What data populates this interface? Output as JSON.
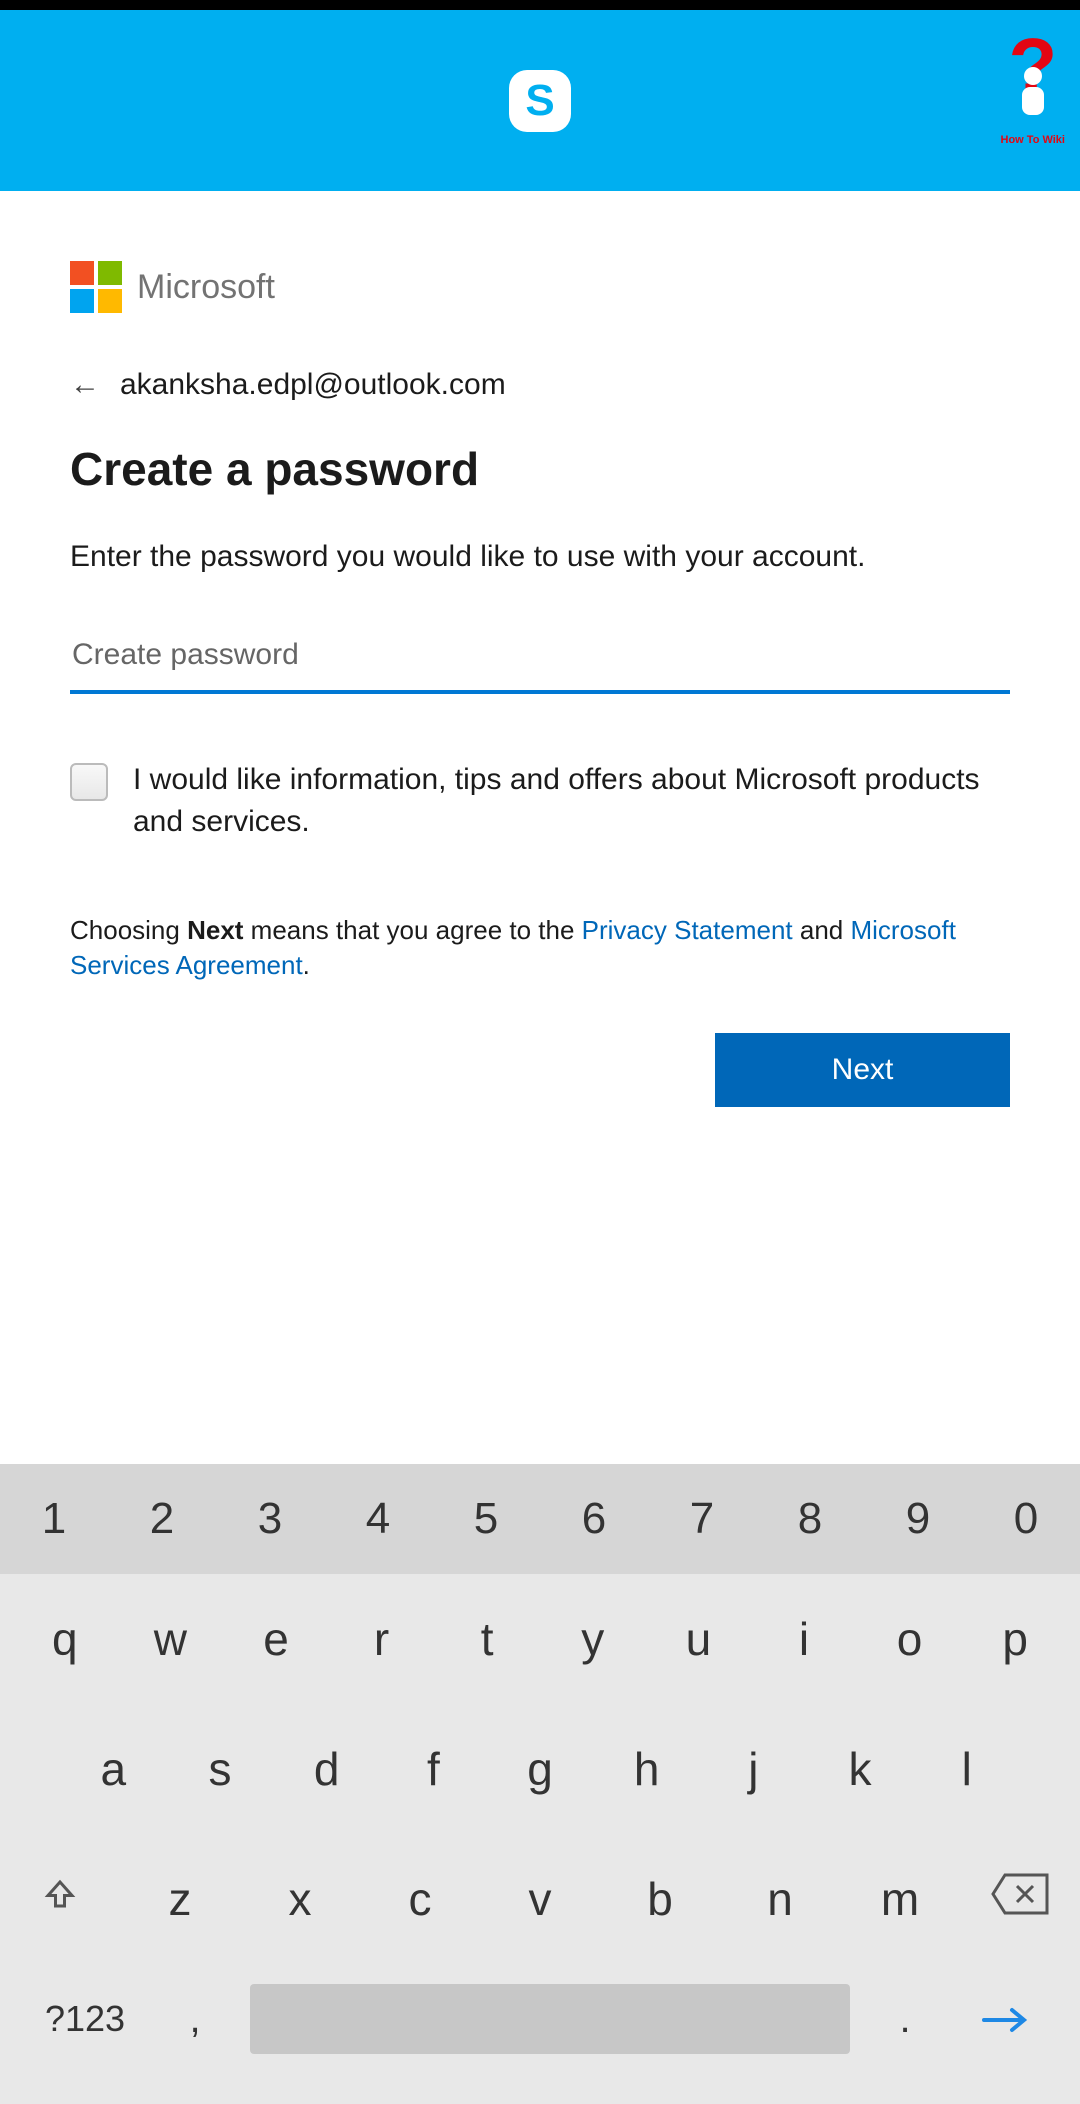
{
  "header": {
    "watermark_text": "How To Wiki"
  },
  "microsoft_label": "Microsoft",
  "email": "akanksha.edpl@outlook.com",
  "title": "Create a password",
  "instruction": "Enter the password you would like to use with your account.",
  "password_placeholder": "Create password",
  "checkbox_label": "I would like information, tips and offers about Microsoft products and services.",
  "agreement": {
    "prefix": "Choosing ",
    "bold": "Next",
    "mid": " means that you agree to the ",
    "link1": "Privacy Statement",
    "and": " and ",
    "link2": "Microsoft Services Agreement",
    "suffix": "."
  },
  "next_button": "Next",
  "keyboard": {
    "numbers": [
      "1",
      "2",
      "3",
      "4",
      "5",
      "6",
      "7",
      "8",
      "9",
      "0"
    ],
    "row1": [
      "q",
      "w",
      "e",
      "r",
      "t",
      "y",
      "u",
      "i",
      "o",
      "p"
    ],
    "row2": [
      "a",
      "s",
      "d",
      "f",
      "g",
      "h",
      "j",
      "k",
      "l"
    ],
    "row3": [
      "z",
      "x",
      "c",
      "v",
      "b",
      "n",
      "m"
    ],
    "sym": "?123",
    "comma": ",",
    "period": "."
  }
}
